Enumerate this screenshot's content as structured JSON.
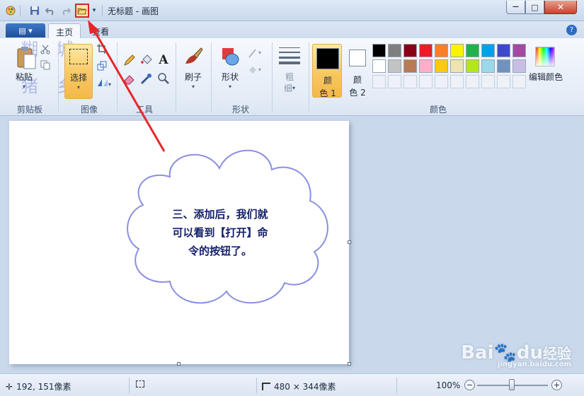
{
  "titlebar": {
    "title": "无标题 - 画图",
    "minimize": "—",
    "maximize": "□",
    "close": "✕"
  },
  "tabs": {
    "file": "▤ ▾",
    "home": "主页",
    "view": "查看",
    "help": "?"
  },
  "ribbon": {
    "clipboard": {
      "paste": "粘贴",
      "group": "剪贴板"
    },
    "image": {
      "select": "选择",
      "group": "图像"
    },
    "tools": {
      "group": "工具"
    },
    "brushes": {
      "label": "刷子"
    },
    "shapes": {
      "label": "形状",
      "group": "形状"
    },
    "size": {
      "label_line1": "粗",
      "label_line2": "细"
    },
    "colors": {
      "color1_line1": "颜",
      "color1_line2": "色 1",
      "color2_line1": "颜",
      "color2_line2": "色 2",
      "edit": "编辑颜色",
      "group": "颜色",
      "color1_value": "#000000",
      "color2_value": "#ffffff",
      "palette_row1": [
        "#000000",
        "#7f7f7f",
        "#880015",
        "#ed1c24",
        "#ff7f27",
        "#fff200",
        "#22b14c",
        "#00a2e8",
        "#3f48cc",
        "#a349a4"
      ],
      "palette_row2": [
        "#ffffff",
        "#c3c3c3",
        "#b97a57",
        "#ffaec9",
        "#ffc90e",
        "#efe4b0",
        "#b5e61d",
        "#99d9ea",
        "#7092be",
        "#c8bfe7"
      ]
    }
  },
  "canvas": {
    "callout_line1": "三、添加后，我们就",
    "callout_line2": "可以看到【打开】命",
    "callout_line3": "令的按钮了。"
  },
  "statusbar": {
    "cursor_pos": "192, 151像素",
    "canvas_size": "480 × 344像素",
    "zoom": "100%",
    "zoom_out": "−",
    "zoom_in": "+"
  },
  "watermark": {
    "brand": "Bai",
    "brand2": "du",
    "jingyan": "经验",
    "site": "jingyan.baidu.com",
    "cn_mark": "糊 城 猪 乡"
  },
  "accent_colors": {
    "annotation_arrow": "#e8262a",
    "cloud_outline": "#8a8fe0",
    "callout_text": "#14206a"
  }
}
